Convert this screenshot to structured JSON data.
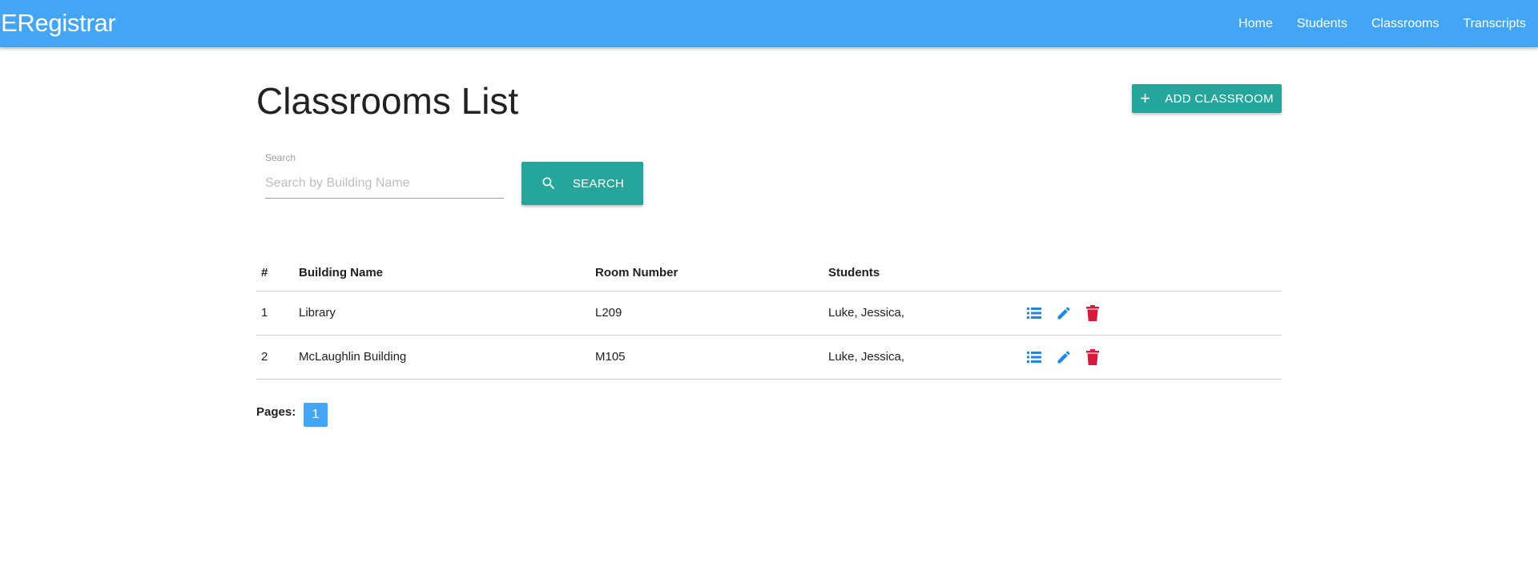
{
  "app": {
    "brand": "ERegistrar"
  },
  "nav": {
    "items": [
      {
        "label": "Home"
      },
      {
        "label": "Students"
      },
      {
        "label": "Classrooms"
      },
      {
        "label": "Transcripts"
      }
    ]
  },
  "page": {
    "title": "Classrooms List",
    "add_button_label": "ADD CLASSROOM",
    "add_button_icon": "plus-icon"
  },
  "search": {
    "label": "Search",
    "placeholder": "Search by Building Name",
    "value": "",
    "button_label": "SEARCH",
    "button_icon": "search-icon"
  },
  "table": {
    "headers": {
      "num": "#",
      "building": "Building Name",
      "room": "Room Number",
      "students": "Students"
    },
    "rows": [
      {
        "num": "1",
        "building": "Library",
        "room": "L209",
        "students": "Luke, Jessica,"
      },
      {
        "num": "2",
        "building": "McLaughlin Building",
        "room": "M105",
        "students": "Luke, Jessica,"
      }
    ],
    "action_icons": [
      "list-icon",
      "edit-icon",
      "delete-icon"
    ]
  },
  "pagination": {
    "label": "Pages:",
    "pages": [
      "1"
    ],
    "current": "1"
  },
  "colors": {
    "navbar": "#42a5f5",
    "accent_button": "#26a69a",
    "view_icon": "#1e88e5",
    "edit_icon": "#1e88e5",
    "delete_icon": "#d81b3c",
    "page_active": "#42a5f5"
  }
}
